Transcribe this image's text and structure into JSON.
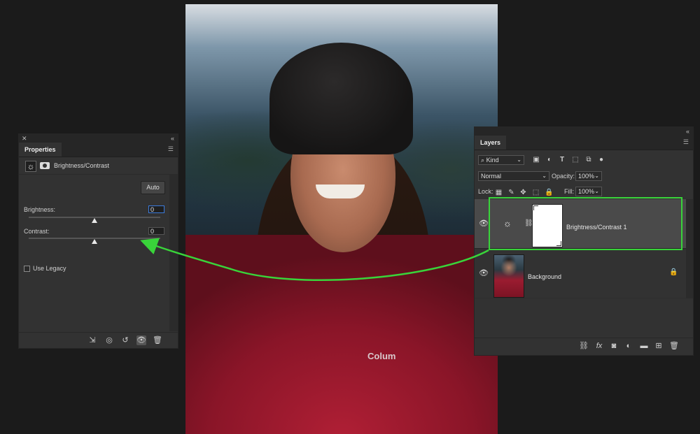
{
  "properties": {
    "tab": "Properties",
    "adjustment_label": "Brightness/Contrast",
    "auto_label": "Auto",
    "brightness_label": "Brightness:",
    "brightness_value": "0",
    "brightness_level": 0.5,
    "contrast_label": "Contrast:",
    "contrast_value": "0",
    "contrast_level": 0.5,
    "legacy_label": "Use Legacy"
  },
  "layers": {
    "tab": "Layers",
    "kind_label": "Kind",
    "blend_mode": "Normal",
    "opacity_label": "Opacity:",
    "opacity_value": "100%",
    "lock_label": "Lock:",
    "fill_label": "Fill:",
    "fill_value": "100%",
    "items": [
      {
        "name": "Brightness/Contrast 1",
        "selected": true
      },
      {
        "name": "Background",
        "locked": true
      }
    ]
  },
  "photo": {
    "jacket_logo": "Colum"
  },
  "colors": {
    "highlight": "#39d43a",
    "panel": "#323232",
    "background": "#1b1b1b"
  }
}
